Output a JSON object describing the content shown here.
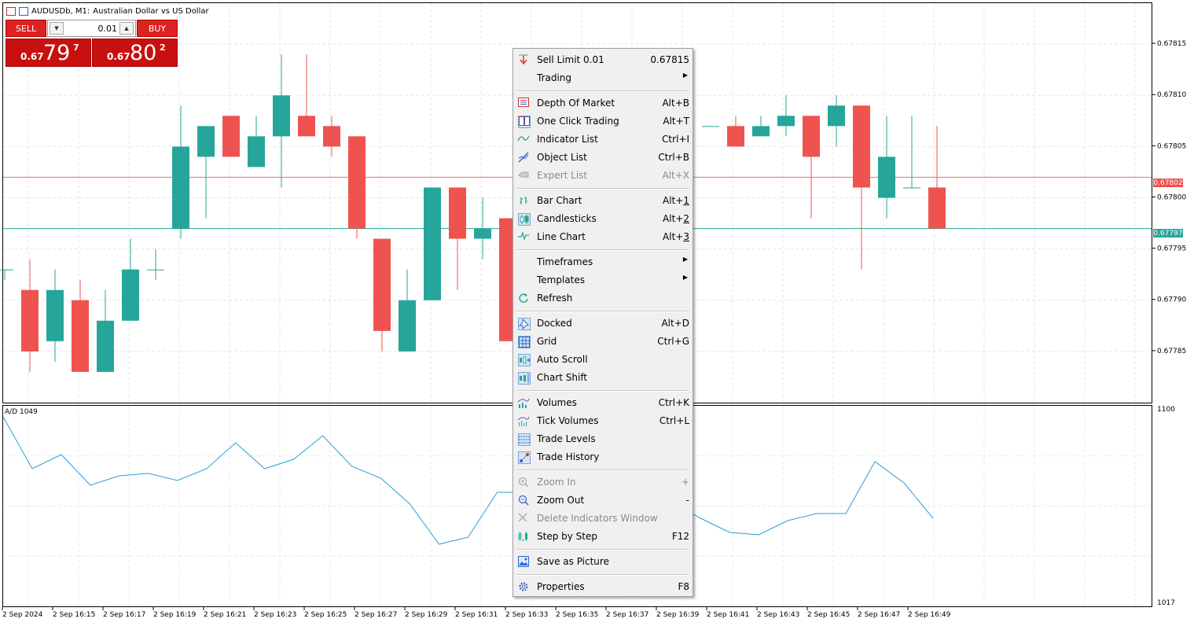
{
  "chart": {
    "title_symbol": "AUDUSDb, M1:",
    "title_desc": "Australian Dollar vs US Dollar",
    "price_axis": [
      "0.67815",
      "0.67810",
      "0.67805",
      "0.67800",
      "0.67795",
      "0.67790",
      "0.67785"
    ],
    "bid_tag": "0.67802",
    "ask_tag": "0.67797",
    "time_axis": [
      "2 Sep 2024",
      "2 Sep 16:15",
      "2 Sep 16:17",
      "2 Sep 16:19",
      "2 Sep 16:21",
      "2 Sep 16:23",
      "2 Sep 16:25",
      "2 Sep 16:27",
      "2 Sep 16:29",
      "2 Sep 16:31",
      "2 Sep 16:33",
      "2 Sep 16:35",
      "2 Sep 16:37",
      "2 Sep 16:39",
      "2 Sep 16:41",
      "2 Sep 16:43",
      "2 Sep 16:45",
      "2 Sep 16:47",
      "2 Sep 16:49"
    ],
    "colors": {
      "bull": "#26a69a",
      "bear": "#ef5350",
      "ad_line": "#2a9fd6",
      "bid_line": "#e57373",
      "ask_line": "#26a69a"
    }
  },
  "trade_panel": {
    "sell_label": "SELL",
    "buy_label": "BUY",
    "lot": "0.01",
    "sell_small": "0.67",
    "sell_big": "79",
    "sell_sup": "7",
    "buy_small": "0.67",
    "buy_big": "80",
    "buy_sup": "2"
  },
  "indicator": {
    "label": "A/D 1049",
    "axis_top": "1100",
    "axis_bottom": "1017"
  },
  "chart_data": {
    "type": "candlestick",
    "timeframe": "M1",
    "ylim": [
      0.6778,
      0.67819
    ],
    "candles": [
      {
        "o": 0.67793,
        "h": 0.67793,
        "l": 0.67792,
        "c": 0.67793
      },
      {
        "o": 0.67791,
        "h": 0.67794,
        "l": 0.67783,
        "c": 0.67785
      },
      {
        "o": 0.67786,
        "h": 0.67793,
        "l": 0.67784,
        "c": 0.67791
      },
      {
        "o": 0.6779,
        "h": 0.67792,
        "l": 0.67783,
        "c": 0.67783
      },
      {
        "o": 0.67783,
        "h": 0.67791,
        "l": 0.67783,
        "c": 0.67788
      },
      {
        "o": 0.67788,
        "h": 0.67796,
        "l": 0.67788,
        "c": 0.67793
      },
      {
        "o": 0.67793,
        "h": 0.67795,
        "l": 0.67792,
        "c": 0.67793
      },
      {
        "o": 0.67797,
        "h": 0.67809,
        "l": 0.67796,
        "c": 0.67805
      },
      {
        "o": 0.67804,
        "h": 0.67807,
        "l": 0.67798,
        "c": 0.67807
      },
      {
        "o": 0.67808,
        "h": 0.67808,
        "l": 0.67804,
        "c": 0.67804
      },
      {
        "o": 0.67803,
        "h": 0.67808,
        "l": 0.67803,
        "c": 0.67806
      },
      {
        "o": 0.67806,
        "h": 0.67814,
        "l": 0.67801,
        "c": 0.6781
      },
      {
        "o": 0.67808,
        "h": 0.67814,
        "l": 0.67806,
        "c": 0.67806
      },
      {
        "o": 0.67807,
        "h": 0.67808,
        "l": 0.67804,
        "c": 0.67805
      },
      {
        "o": 0.67806,
        "h": 0.67806,
        "l": 0.67796,
        "c": 0.67797
      },
      {
        "o": 0.67796,
        "h": 0.67796,
        "l": 0.67785,
        "c": 0.67787
      },
      {
        "o": 0.67785,
        "h": 0.67793,
        "l": 0.67785,
        "c": 0.6779
      },
      {
        "o": 0.6779,
        "h": 0.67801,
        "l": 0.6779,
        "c": 0.67801
      },
      {
        "o": 0.67801,
        "h": 0.67801,
        "l": 0.67791,
        "c": 0.67796
      },
      {
        "o": 0.67796,
        "h": 0.678,
        "l": 0.67794,
        "c": 0.67797
      },
      {
        "o": 0.67798,
        "h": 0.67798,
        "l": 0.67786,
        "c": 0.67786
      },
      {
        "o": 0.67807,
        "h": 0.67807,
        "l": 0.67807,
        "c": 0.67807
      },
      {
        "o": 0.67807,
        "h": 0.67808,
        "l": 0.67805,
        "c": 0.67805
      },
      {
        "o": 0.67806,
        "h": 0.67808,
        "l": 0.67806,
        "c": 0.67807
      },
      {
        "o": 0.67807,
        "h": 0.6781,
        "l": 0.67806,
        "c": 0.67808
      },
      {
        "o": 0.67808,
        "h": 0.67808,
        "l": 0.67798,
        "c": 0.67804
      },
      {
        "o": 0.67807,
        "h": 0.6781,
        "l": 0.67805,
        "c": 0.67809
      },
      {
        "o": 0.67809,
        "h": 0.67809,
        "l": 0.67793,
        "c": 0.67801
      },
      {
        "o": 0.678,
        "h": 0.67808,
        "l": 0.67798,
        "c": 0.67804
      },
      {
        "o": 0.67801,
        "h": 0.67808,
        "l": 0.67801,
        "c": 0.67801
      },
      {
        "o": 0.67801,
        "h": 0.67807,
        "l": 0.67797,
        "c": 0.67797
      }
    ],
    "bid": 0.67802,
    "ask": 0.67797,
    "ad_series": {
      "name": "A/D",
      "ylim": [
        1017,
        1100
      ],
      "values": [
        1096,
        1074,
        1080,
        1067,
        1071,
        1072,
        1069,
        1074,
        1085,
        1074,
        1078,
        1088,
        1075,
        1070,
        1059,
        1042,
        1045,
        1064,
        1064,
        1064,
        1055,
        1050,
        1052,
        1060,
        1053,
        1047,
        1046,
        1052,
        1055,
        1055,
        1077,
        1068,
        1053
      ]
    }
  },
  "context_menu": {
    "items": [
      {
        "label": "Sell Limit 0.01",
        "shortcut": "0.67815",
        "icon": "sell-limit-icon"
      },
      {
        "label": "Trading",
        "submenu": true
      },
      {
        "sep": true
      },
      {
        "label": "Depth Of Market",
        "shortcut": "Alt+B",
        "icon": "depth-of-market-icon"
      },
      {
        "label": "One Click Trading",
        "shortcut": "Alt+T",
        "icon": "one-click-trading-icon",
        "selected": true
      },
      {
        "label": "Indicator List",
        "shortcut": "Ctrl+I",
        "icon": "indicator-list-icon"
      },
      {
        "label": "Object List",
        "shortcut": "Ctrl+B",
        "icon": "object-list-icon"
      },
      {
        "label": "Expert List",
        "shortcut": "Alt+X",
        "icon": "expert-list-icon",
        "disabled": true
      },
      {
        "sep": true
      },
      {
        "label": "Bar Chart",
        "shortcut_pre": "Alt+",
        "shortcut_u": "1",
        "icon": "bar-chart-icon"
      },
      {
        "label": "Candlesticks",
        "shortcut_pre": "Alt+",
        "shortcut_u": "2",
        "icon": "candlesticks-icon",
        "selected": true
      },
      {
        "label": "Line Chart",
        "shortcut_pre": "Alt+",
        "shortcut_u": "3",
        "icon": "line-chart-icon"
      },
      {
        "sep": true
      },
      {
        "label": "Timeframes",
        "submenu": true
      },
      {
        "label": "Templates",
        "submenu": true
      },
      {
        "label": "Refresh",
        "icon": "refresh-icon"
      },
      {
        "sep": true
      },
      {
        "label": "Docked",
        "shortcut": "Alt+D",
        "icon": "docked-icon",
        "selected": true
      },
      {
        "label": "Grid",
        "shortcut": "Ctrl+G",
        "icon": "grid-icon",
        "selected": true
      },
      {
        "label": "Auto Scroll",
        "icon": "auto-scroll-icon",
        "selected": true
      },
      {
        "label": "Chart Shift",
        "icon": "chart-shift-icon",
        "selected": true
      },
      {
        "sep": true
      },
      {
        "label": "Volumes",
        "shortcut": "Ctrl+K",
        "icon": "volumes-icon"
      },
      {
        "label": "Tick Volumes",
        "shortcut": "Ctrl+L",
        "icon": "tick-volumes-icon"
      },
      {
        "label": "Trade Levels",
        "icon": "trade-levels-icon",
        "selected": true
      },
      {
        "label": "Trade History",
        "icon": "trade-history-icon",
        "selected": true
      },
      {
        "sep": true
      },
      {
        "label": "Zoom In",
        "shortcut": "+",
        "icon": "zoom-in-icon",
        "disabled": true
      },
      {
        "label": "Zoom Out",
        "shortcut": "-",
        "icon": "zoom-out-icon"
      },
      {
        "label": "Delete Indicators Window",
        "icon": "delete-icon",
        "disabled": true
      },
      {
        "label": "Step by Step",
        "shortcut": "F12",
        "icon": "step-by-step-icon"
      },
      {
        "sep": true
      },
      {
        "label": "Save as Picture",
        "icon": "save-picture-icon"
      },
      {
        "sep": true
      },
      {
        "label": "Properties",
        "shortcut": "F8",
        "icon": "properties-icon"
      }
    ]
  }
}
